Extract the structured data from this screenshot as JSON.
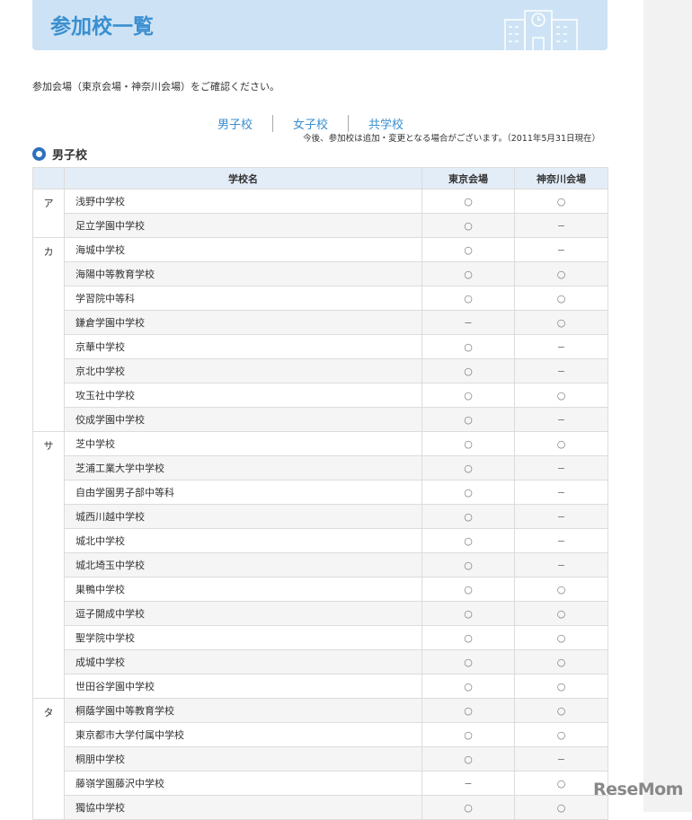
{
  "title": "参加校一覧",
  "intro": "参加会場（東京会場・神奈川会場）をご確認ください。",
  "nav": [
    "男子校",
    "女子校",
    "共学校"
  ],
  "note": "今後、参加校は追加・変更となる場合がございます。（2011年5月31日現在）",
  "section": "男子校",
  "headers": {
    "name": "学校名",
    "tokyo": "東京会場",
    "kanagawa": "神奈川会場"
  },
  "groups": [
    {
      "kana": "ア",
      "rows": [
        [
          "浅野中学校",
          "○",
          "○"
        ],
        [
          "足立学園中学校",
          "○",
          "−"
        ]
      ]
    },
    {
      "kana": "カ",
      "rows": [
        [
          "海城中学校",
          "○",
          "−"
        ],
        [
          "海陽中等教育学校",
          "○",
          "○"
        ],
        [
          "学習院中等科",
          "○",
          "○"
        ],
        [
          "鎌倉学園中学校",
          "−",
          "○"
        ],
        [
          "京華中学校",
          "○",
          "−"
        ],
        [
          "京北中学校",
          "○",
          "−"
        ],
        [
          "攻玉社中学校",
          "○",
          "○"
        ],
        [
          "佼成学園中学校",
          "○",
          "−"
        ]
      ]
    },
    {
      "kana": "サ",
      "rows": [
        [
          "芝中学校",
          "○",
          "○"
        ],
        [
          "芝浦工業大学中学校",
          "○",
          "−"
        ],
        [
          "自由学園男子部中等科",
          "○",
          "−"
        ],
        [
          "城西川越中学校",
          "○",
          "−"
        ],
        [
          "城北中学校",
          "○",
          "−"
        ],
        [
          "城北埼玉中学校",
          "○",
          "−"
        ],
        [
          "巣鴨中学校",
          "○",
          "○"
        ],
        [
          "逗子開成中学校",
          "○",
          "○"
        ],
        [
          "聖学院中学校",
          "○",
          "○"
        ],
        [
          "成城中学校",
          "○",
          "○"
        ],
        [
          "世田谷学園中学校",
          "○",
          "○"
        ]
      ]
    },
    {
      "kana": "タ",
      "rows": [
        [
          "桐蔭学園中等教育学校",
          "○",
          "○"
        ],
        [
          "東京都市大学付属中学校",
          "○",
          "○"
        ],
        [
          "桐朋中学校",
          "○",
          "−"
        ],
        [
          "藤嶺学園藤沢中学校",
          "−",
          "○"
        ],
        [
          "獨協中学校",
          "○",
          "○"
        ]
      ]
    }
  ],
  "watermark": "ReseMom"
}
